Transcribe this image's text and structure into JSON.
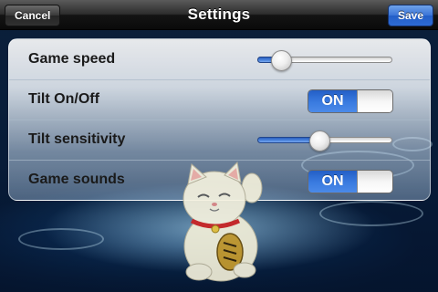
{
  "navbar": {
    "title": "Settings",
    "cancel_label": "Cancel",
    "save_label": "Save"
  },
  "settings": {
    "game_speed": {
      "label": "Game speed",
      "value": 0.17
    },
    "tilt": {
      "label": "Tilt On/Off",
      "state": "ON"
    },
    "tilt_sensitivity": {
      "label": "Tilt sensitivity",
      "value": 0.45
    },
    "game_sounds": {
      "label": "Game sounds",
      "state": "ON"
    }
  },
  "colors": {
    "accent": "#3a7be0",
    "navbar": "#1e1e1e"
  },
  "icons": {
    "mascot": "lucky-cat-icon"
  }
}
